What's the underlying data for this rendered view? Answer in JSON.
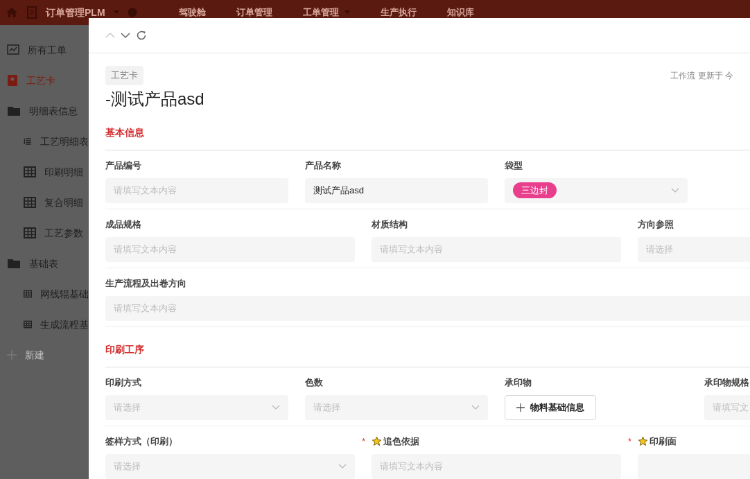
{
  "topbar": {
    "app_title": "订单管理PLM",
    "nav": [
      {
        "label": "驾驶舱",
        "has_menu": false
      },
      {
        "label": "订单管理",
        "has_menu": false
      },
      {
        "label": "工单管理",
        "has_menu": true
      },
      {
        "label": "生产执行",
        "has_menu": false
      },
      {
        "label": "知识库",
        "has_menu": false
      }
    ]
  },
  "sidebar": {
    "items": [
      {
        "label": "所有工单",
        "kind": "chart",
        "selected": false
      },
      {
        "label": "工艺卡",
        "kind": "card",
        "selected": true
      },
      {
        "label": "明细表信息",
        "kind": "folder",
        "selected": false,
        "children": [
          {
            "label": "工艺明细表",
            "kind": "list",
            "selected": false
          },
          {
            "label": "印刷明细",
            "kind": "grid",
            "selected": false
          },
          {
            "label": "复合明细",
            "kind": "grid",
            "selected": false
          },
          {
            "label": "工艺参数",
            "kind": "grid",
            "selected": false
          }
        ]
      },
      {
        "label": "基础表",
        "kind": "folder",
        "selected": false,
        "children": [
          {
            "label": "网线辊基础",
            "kind": "grid",
            "selected": false
          },
          {
            "label": "生成流程基",
            "kind": "grid",
            "selected": false
          }
        ]
      }
    ],
    "new_item": "新建"
  },
  "modal": {
    "tag": "工艺卡",
    "meta": "工作流 更新于 今",
    "title": "-测试产品asd",
    "sections": [
      {
        "title": "基本信息",
        "rows": [
          {
            "kind": "quad",
            "fields": [
              {
                "label": "产品编号",
                "kind": "text",
                "placeholder": "请填写文本内容"
              },
              {
                "label": "产品名称",
                "kind": "text",
                "value": "测试产品asd"
              },
              {
                "label": "袋型",
                "kind": "select",
                "tag": "三边封"
              }
            ]
          },
          {
            "kind": "triple",
            "fields": [
              {
                "label": "成品规格",
                "kind": "text",
                "placeholder": "请填写文本内容"
              },
              {
                "label": "材质结构",
                "kind": "text",
                "placeholder": "请填写文本内容"
              },
              {
                "label": "方向参照",
                "kind": "select",
                "placeholder": "请选择"
              }
            ]
          },
          {
            "kind": "full",
            "fields": [
              {
                "label": "生产流程及出卷方向",
                "kind": "text",
                "placeholder": "请填写文本内容"
              }
            ]
          }
        ]
      },
      {
        "title": "印刷工序",
        "rows": [
          {
            "kind": "quad",
            "fields": [
              {
                "label": "印刷方式",
                "kind": "select",
                "placeholder": "请选择"
              },
              {
                "label": "色数",
                "kind": "select",
                "placeholder": "请选择"
              },
              {
                "label": "承印物",
                "kind": "button",
                "button": "物料基础信息"
              },
              {
                "label": "承印物规格",
                "kind": "text",
                "placeholder": "请填写文"
              }
            ]
          },
          {
            "kind": "triple",
            "fields": [
              {
                "label": "签样方式（印刷）",
                "kind": "select",
                "placeholder": "请选择"
              },
              {
                "label": "追色依据",
                "kind": "text",
                "placeholder": "请填写文本内容",
                "required_mark": "*",
                "starred": true
              },
              {
                "label": "印刷面",
                "kind": "text",
                "required_mark": "*",
                "starred": true
              }
            ]
          }
        ]
      }
    ]
  }
}
